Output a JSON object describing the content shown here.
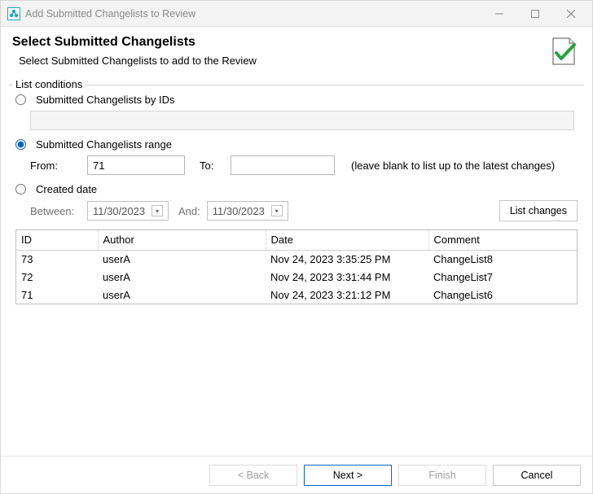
{
  "window": {
    "title": "Add Submitted Changelists to Review"
  },
  "header": {
    "heading": "Select Submitted Changelists",
    "description": "Select Submitted Changelists to add to the Review"
  },
  "conditions": {
    "legend": "List conditions",
    "by_ids": {
      "label": "Submitted Changelists by IDs",
      "value": ""
    },
    "range": {
      "label": "Submitted Changelists range",
      "from_label": "From:",
      "from_value": "71",
      "to_label": "To:",
      "to_value": "",
      "hint": "(leave blank to list up to the latest changes)"
    },
    "created": {
      "label": "Created date",
      "between_label": "Between:",
      "between_value": "11/30/2023",
      "and_label": "And:",
      "and_value": "11/30/2023"
    },
    "selected": "range",
    "list_button": "List changes"
  },
  "table": {
    "columns": {
      "id": "ID",
      "author": "Author",
      "date": "Date",
      "comment": "Comment"
    },
    "rows": [
      {
        "id": "73",
        "author": "userA",
        "date": "Nov 24, 2023 3:35:25 PM",
        "comment": "ChangeList8"
      },
      {
        "id": "72",
        "author": "userA",
        "date": "Nov 24, 2023 3:31:44 PM",
        "comment": "ChangeList7"
      },
      {
        "id": "71",
        "author": "userA",
        "date": "Nov 24, 2023 3:21:12 PM",
        "comment": "ChangeList6"
      }
    ]
  },
  "footer": {
    "back": "< Back",
    "next": "Next >",
    "finish": "Finish",
    "cancel": "Cancel"
  }
}
